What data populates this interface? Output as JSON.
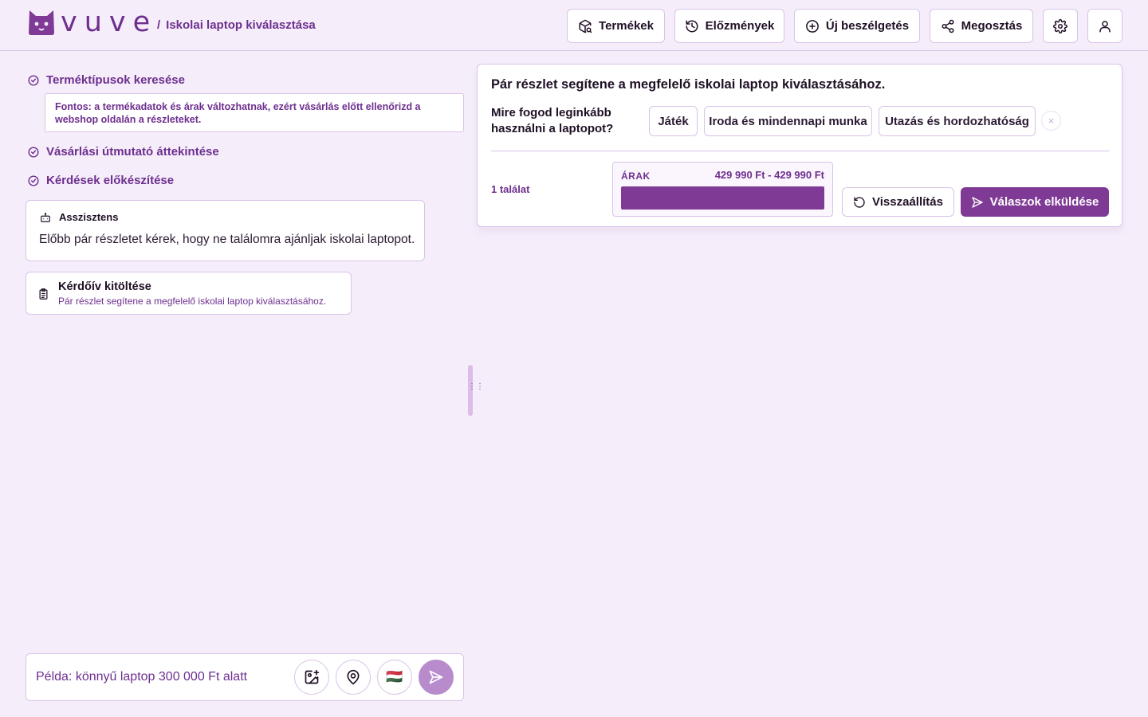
{
  "brand": {
    "name": "vuve",
    "accent": "#7f3a95",
    "logo_icon": "cat-logo-icon"
  },
  "header": {
    "breadcrumb_sep": "/",
    "title": "Iskolai laptop kiválasztása",
    "buttons": {
      "products": "Termékek",
      "history": "Előzmények",
      "new_chat": "Új beszélgetés",
      "share": "Megosztás"
    }
  },
  "steps": [
    {
      "label": "Terméktípusok keresése",
      "status": "done"
    },
    {
      "label": "Vásárlási útmutató áttekintése",
      "status": "done"
    },
    {
      "label": "Kérdések előkészítése",
      "status": "done"
    }
  ],
  "notice": "Fontos: a termékadatok és árak változhatnak, ezért vásárlás előtt ellenőrizd a webshop oldalán a részleteket.",
  "assistant": {
    "label": "Asszisztens",
    "message": "Előbb pár részletet kérek, hogy ne találomra ajánljak iskolai laptopot."
  },
  "survey": {
    "title": "Kérdőív kitöltése",
    "subtitle": "Pár részlet segítene a megfelelő iskolai laptop kiválasztásához."
  },
  "composer": {
    "placeholder": "Példa: könnyű laptop 300 000 Ft alatt",
    "flag": "🇭🇺"
  },
  "question_card": {
    "title": "Pár részlet segítene a megfelelő iskolai laptop kiválasztásához.",
    "question": "Mire fogod leginkább használni a laptopot?",
    "options": [
      "Játék",
      "Iroda és mindennapi munka",
      "Utazás és hordozhatóság"
    ],
    "clear_symbol": "×",
    "hits": "1 találat",
    "price": {
      "label": "ÁRAK",
      "range": "429 990 Ft - 429 990 Ft",
      "fill_fraction": 1.0
    },
    "reset_label": "Visszaállítás",
    "submit_label": "Válaszok elküldése"
  }
}
